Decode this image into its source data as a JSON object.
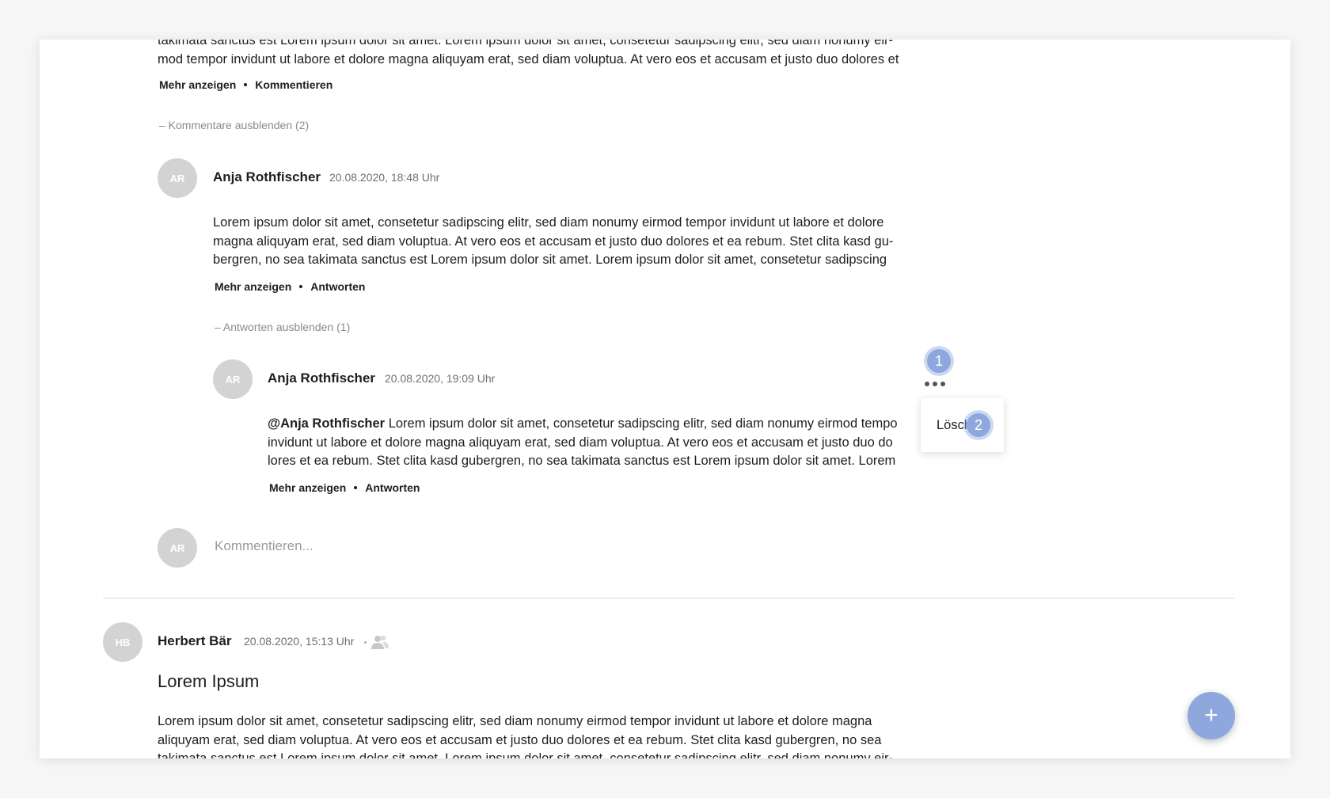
{
  "top_post": {
    "body_tail": [
      "takimata sanctus est Lorem ipsum dolor sit amet. Lorem ipsum dolor sit amet, consetetur sadipscing elitr, sed diam nonumy eir-",
      "mod tempor invidunt ut labore et dolore magna aliquyam erat, sed diam voluptua. At vero eos et accusam et justo duo dolores et"
    ],
    "show_more_label": "Mehr anzeigen",
    "comment_label": "Kommentieren",
    "hide_comments_label": "– Kommentare ausblenden (2)"
  },
  "comment": {
    "avatar_initials": "AR",
    "author": "Anja Rothfischer",
    "date": "20.08.2020, 18:48 Uhr",
    "body": [
      "Lorem ipsum dolor sit amet, consetetur sadipscing elitr, sed diam nonumy eirmod tempor invidunt ut labore et dolore",
      "magna aliquyam erat, sed diam voluptua. At vero eos et accusam et justo duo dolores et ea rebum. Stet clita kasd gu-",
      "bergren, no sea takimata sanctus est Lorem ipsum dolor sit amet. Lorem ipsum dolor sit amet, consetetur sadipscing"
    ],
    "show_more_label": "Mehr anzeigen",
    "reply_label": "Antworten",
    "hide_replies_label": "– Antworten ausblenden (1)"
  },
  "reply": {
    "avatar_initials": "AR",
    "author": "Anja Rothfischer",
    "date": "20.08.2020, 19:09 Uhr",
    "mention": "@Anja Rothfischer",
    "body_first": " Lorem ipsum dolor sit amet, consetetur sadipscing elitr, sed diam nonumy eirmod tempo",
    "body": [
      "invidunt ut labore et dolore magna aliquyam erat, sed diam voluptua. At vero eos et accusam et justo duo do",
      "lores et ea rebum. Stet clita kasd gubergren, no sea takimata sanctus est Lorem ipsum dolor sit amet. Lorem"
    ],
    "show_more_label": "Mehr anzeigen",
    "reply_label": "Antworten",
    "menu_item_delete": "Lösch",
    "badge_1": "1",
    "badge_2": "2"
  },
  "comment_input": {
    "avatar_initials": "AR",
    "placeholder": "Kommentieren..."
  },
  "next_post": {
    "avatar_initials": "HB",
    "author": "Herbert Bär",
    "date": "20.08.2020, 15:13 Uhr",
    "title": "Lorem Ipsum",
    "body": [
      "Lorem ipsum dolor sit amet, consetetur sadipscing elitr, sed diam nonumy eirmod tempor invidunt ut labore et dolore magna",
      "aliquyam erat, sed diam voluptua. At vero eos et accusam et justo duo dolores et ea rebum. Stet clita kasd gubergren, no sea",
      "takimata sanctus est Lorem ipsum dolor sit amet. Lorem ipsum dolor sit amet, consetetur sadipscing elitr, sed diam nonumy eir-"
    ]
  },
  "fab": {
    "label": "+"
  },
  "colors": {
    "accent": "#8ea8de",
    "avatar": "#d3d3d3",
    "muted_text": "#8a8a8a"
  },
  "icons": {
    "group": "group-icon",
    "more": "more-horizontal-icon",
    "add": "plus-icon"
  }
}
